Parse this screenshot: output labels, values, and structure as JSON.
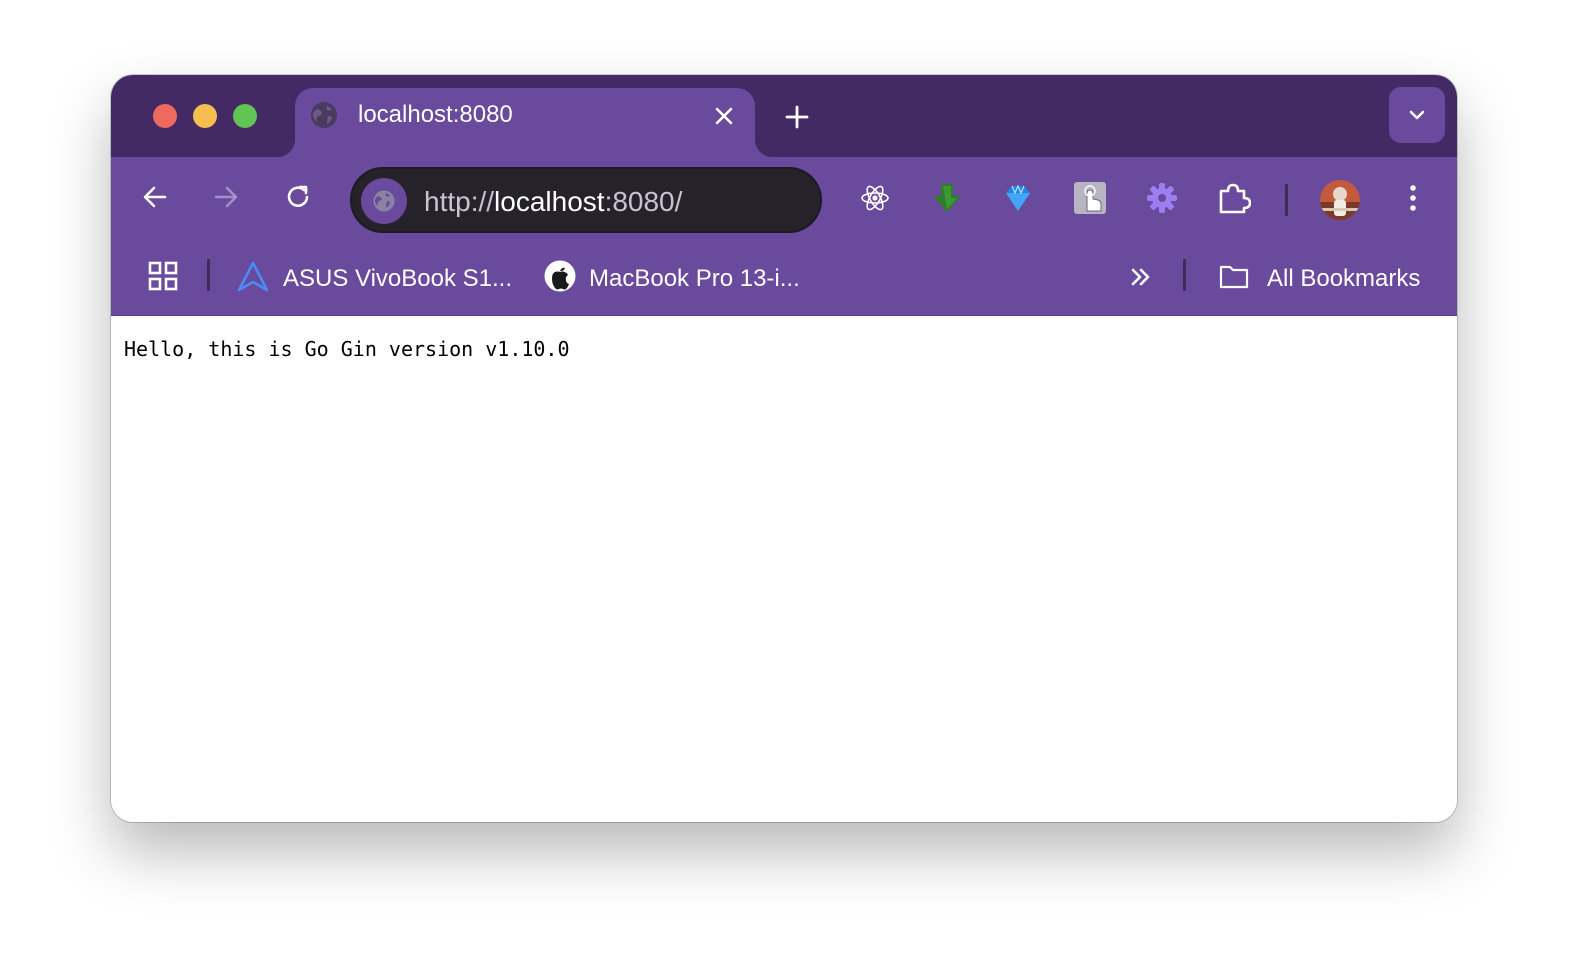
{
  "tab": {
    "title": "localhost:8080",
    "favicon": "globe-icon",
    "close_icon": "close-icon"
  },
  "new_tab_icon": "plus-icon",
  "tab_list_icon": "chevron-down-icon",
  "toolbar": {
    "back_icon": "arrow-left-icon",
    "forward_icon": "arrow-right-icon",
    "reload_icon": "reload-icon",
    "site_info_icon": "globe-icon",
    "url_scheme": "http://",
    "url_host": "localhost",
    "url_rest": ":8080/",
    "extensions": [
      "react-devtools-icon",
      "download-arrow-icon",
      "gem-icon",
      "touch-hand-icon",
      "gear-icon",
      "puzzle-icon"
    ],
    "menu_icon": "more-vertical-icon"
  },
  "bookmarks": {
    "apps_icon": "apps-grid-icon",
    "items": [
      {
        "label": "ASUS VivoBook S1...",
        "icon": "asus-triangle-icon"
      },
      {
        "label": "MacBook Pro 13-i...",
        "icon": "apple-icon"
      }
    ],
    "overflow_icon": "double-chevron-right-icon",
    "all_bookmarks": {
      "label": "All Bookmarks",
      "icon": "folder-icon"
    }
  },
  "page": {
    "text": "Hello, this is Go Gin version v1.10.0"
  },
  "colors": {
    "titlebar": "#432a64",
    "toolbar": "#694a9d",
    "omnibox": "#25222a"
  }
}
